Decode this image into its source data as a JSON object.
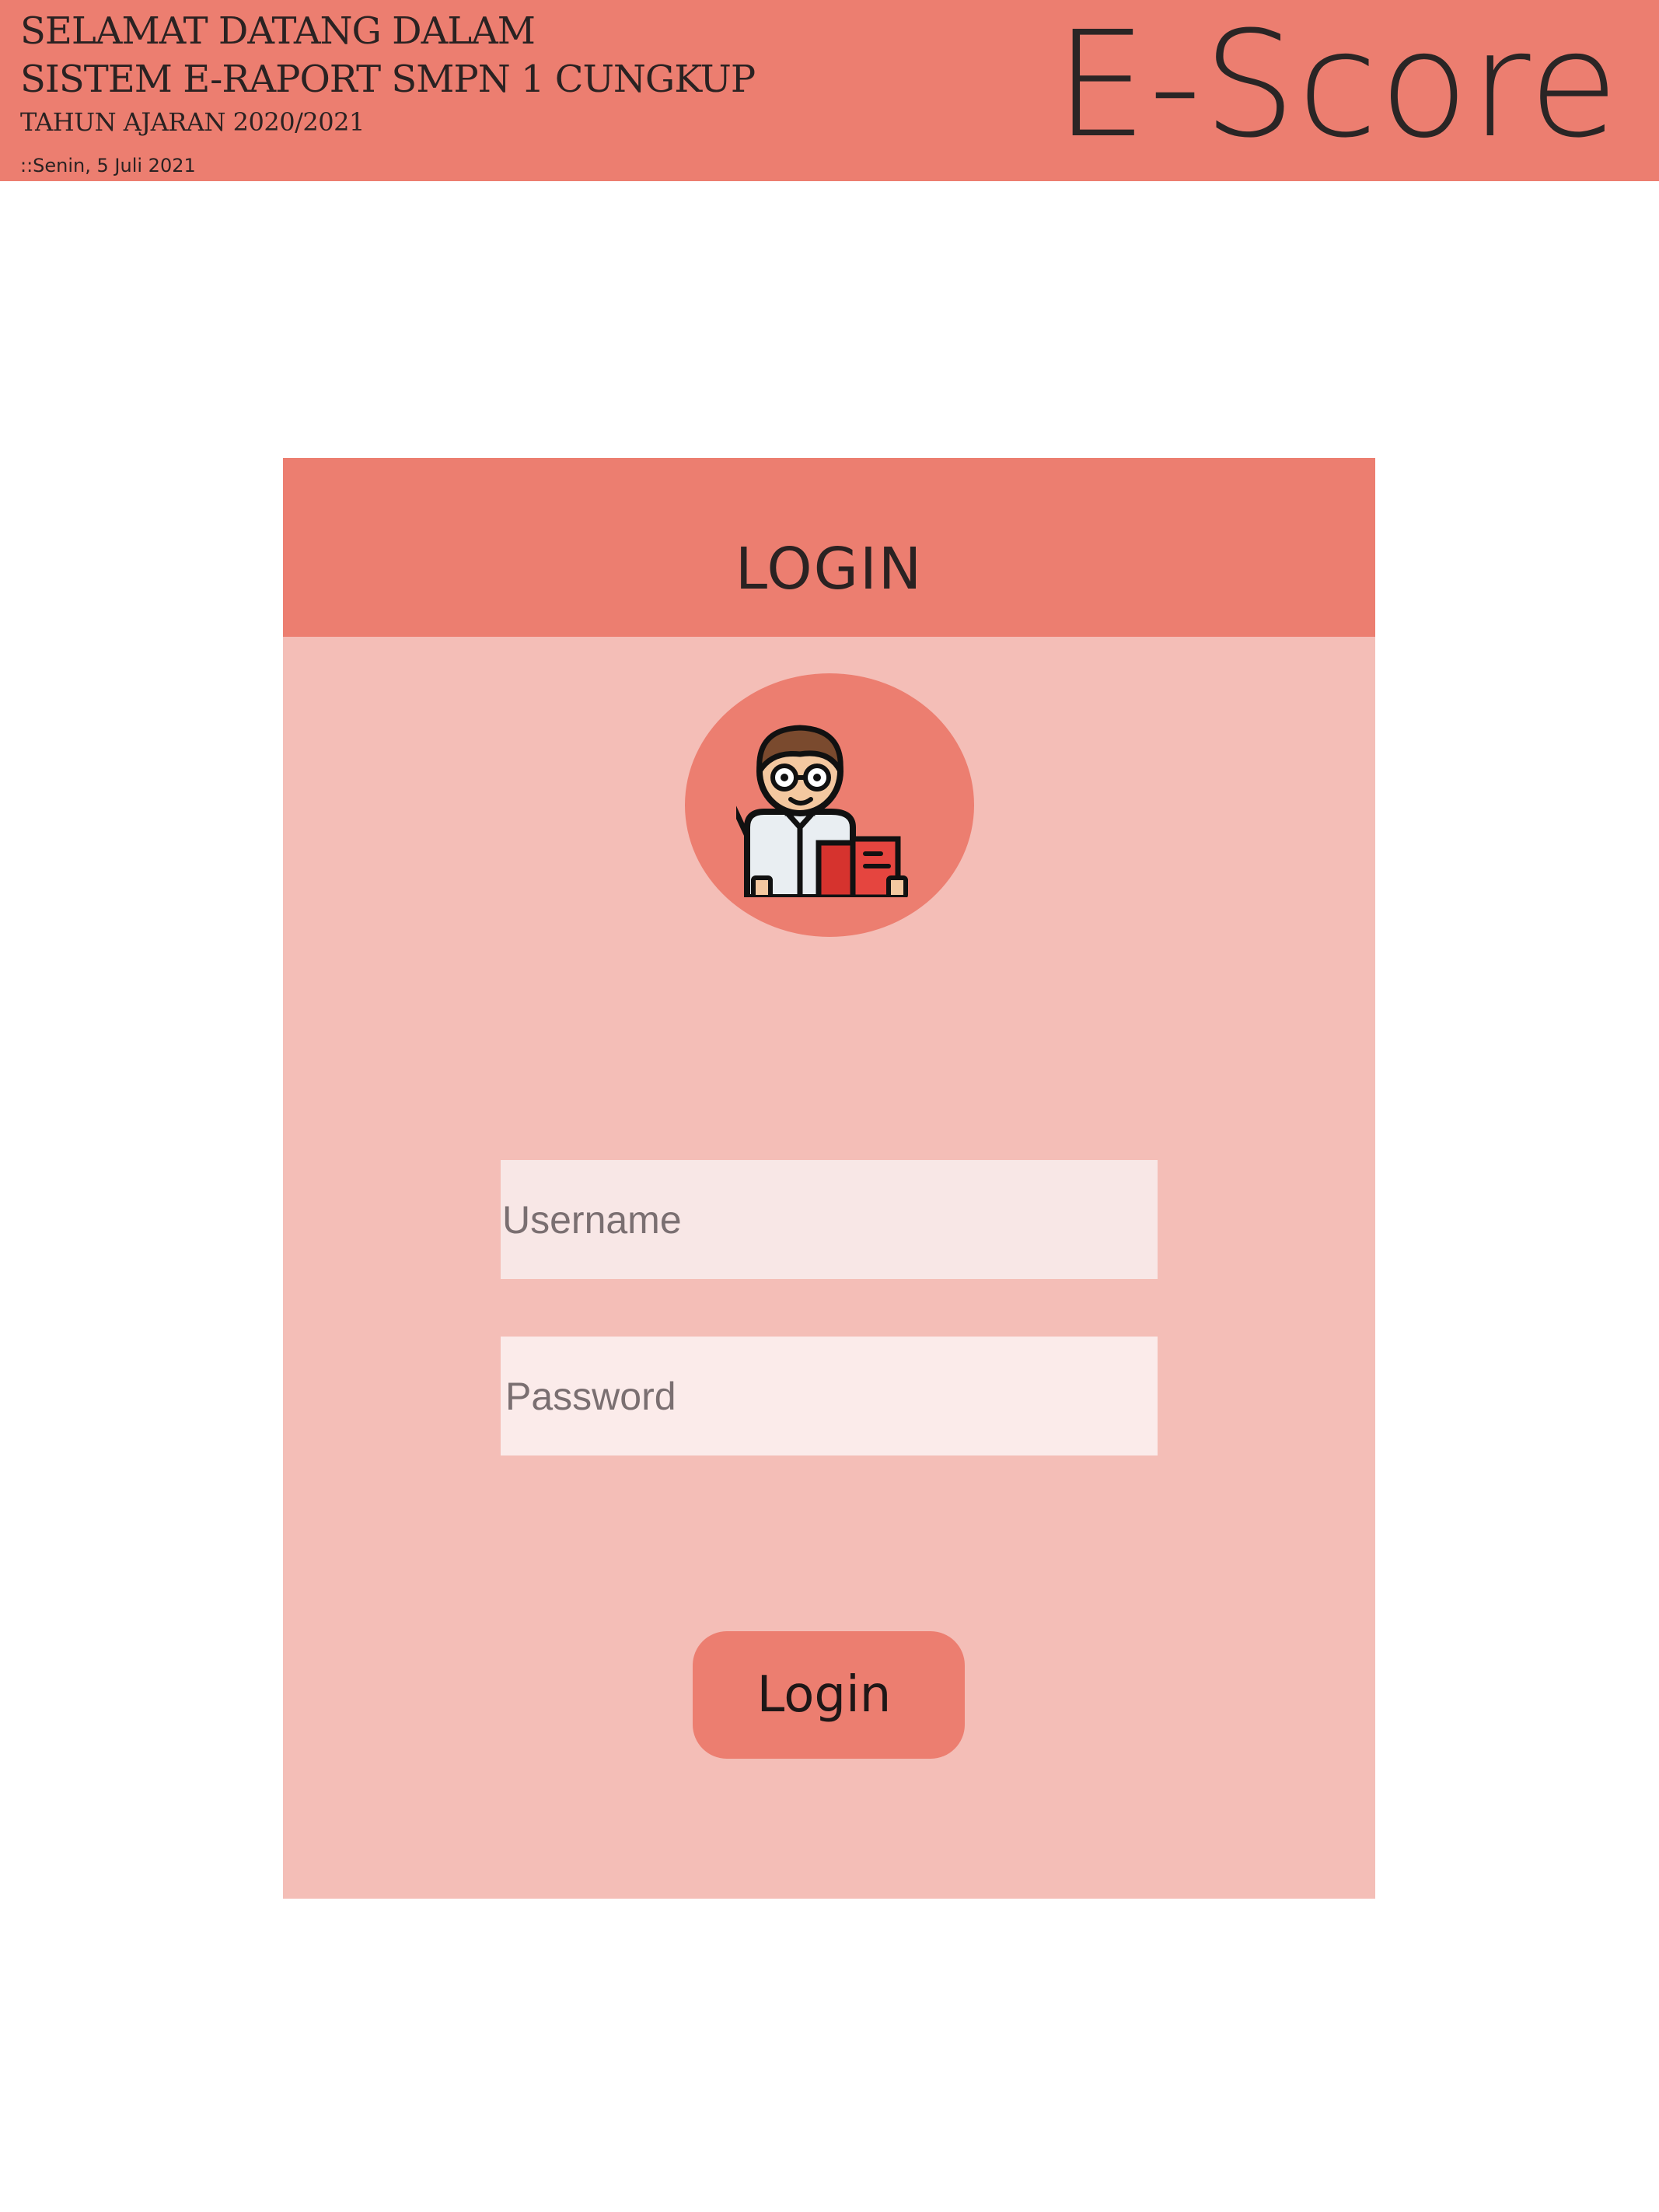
{
  "header": {
    "welcome_line1": "SELAMAT DATANG DALAM",
    "welcome_line2": "SISTEM E-RAPORT SMPN 1 CUNGKUP",
    "academic_year": "TAHUN AJARAN 2020/2021",
    "date": "::Senin, 5 Juli 2021",
    "brand": "E-Score"
  },
  "login_card": {
    "title": "LOGIN",
    "avatar_icon": "teacher-avatar-icon",
    "username_placeholder": "Username",
    "username_value": "",
    "password_placeholder": "Password",
    "password_value": "",
    "login_button_label": "Login"
  },
  "colors": {
    "accent": "#ec7e70",
    "card_background": "#f4beb7",
    "input_background": "#f8e7e6",
    "text_dark": "#2a2222"
  }
}
